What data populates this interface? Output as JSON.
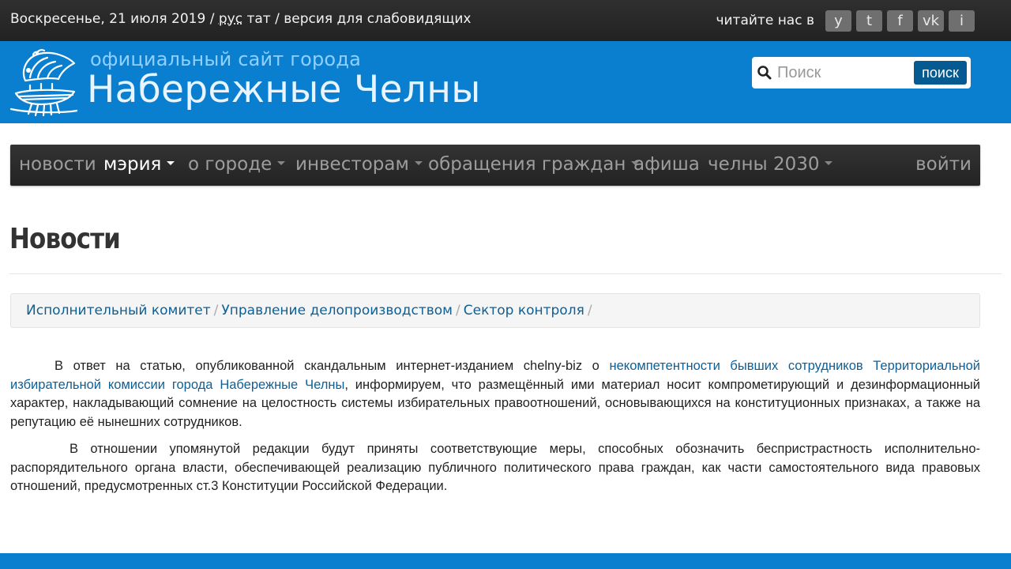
{
  "topbar": {
    "date": "Воскресенье, 21 июля 2019",
    "sep1": " / ",
    "lang_rus": "рус",
    "lang_tat": " тат",
    "sep2": " / ",
    "low_vision": "версия для слабовидящих",
    "read_us": "читайте нас в",
    "social": [
      {
        "label": "y",
        "icon": "youtube-icon"
      },
      {
        "label": "t",
        "icon": "twitter-icon"
      },
      {
        "label": "f",
        "icon": "facebook-icon"
      },
      {
        "label": "vk",
        "icon": "vk-icon"
      },
      {
        "label": "i",
        "icon": "instagram-icon"
      }
    ]
  },
  "header": {
    "subtitle": "официальный сайт города",
    "title": "Набережные Челны",
    "search_placeholder": "Поиск",
    "search_button": "поиск"
  },
  "nav": {
    "items": [
      {
        "label": "новости",
        "dropdown": false,
        "active": false
      },
      {
        "label": "мэрия",
        "dropdown": true,
        "active": true
      },
      {
        "label": "о городе",
        "dropdown": true,
        "active": false
      },
      {
        "label": "инвесторам",
        "dropdown": true,
        "active": false
      },
      {
        "label": "обращения граждан",
        "dropdown": true,
        "active": false
      },
      {
        "label": "афиша",
        "dropdown": false,
        "active": false
      },
      {
        "label": "челны 2030",
        "dropdown": true,
        "active": false
      }
    ],
    "login": "войти"
  },
  "page": {
    "title": "Новости"
  },
  "breadcrumb": {
    "items": [
      "Исполнительный комитет",
      "Управление делопроизводством",
      "Сектор контроля"
    ],
    "separator": "/"
  },
  "article": {
    "p1_a": "В ответ на статью, опубликованной скандальным интернет-изданием chelny-biz о ",
    "p1_link": "некомпетентности бывших сотрудников Территориальной избирательной комиссии города Набережные Челны",
    "p1_b": ", информируем, что размещённый ими материал носит компрометирующий и дезинформационный характер, накладывающий сомнение на целостность системы избирательных правоотношений, основывающихся на конституционных признаках, а также на репутацию её нынешних сотрудников.",
    "p2": "В отношении упомянутой редакции будут приняты соответствующие меры, способных обозначить беспристрастность исполнительно-распорядительного органа власти, обеспечивающей реализацию публичного политического права граждан, как части самостоятельного вида правовых отношений, предусмотренных ст.3 Конституции Российской Федерации."
  },
  "colors": {
    "header_blue": "#0a7fcf",
    "topbar_dark": "#2a2a2a",
    "link": "#0d5f96",
    "search_button": "#055a91"
  }
}
